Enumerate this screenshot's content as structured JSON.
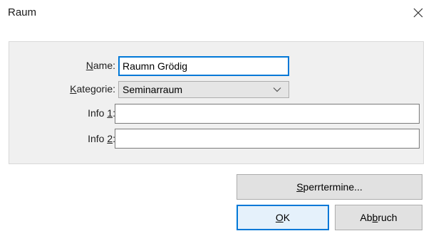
{
  "window": {
    "title": "Raum",
    "close_glyph": "close-icon"
  },
  "form": {
    "name": {
      "label_mnemonic": "N",
      "label_rest": "ame:",
      "value": "Raumn Grödig"
    },
    "kategorie": {
      "label_mnemonic": "K",
      "label_rest": "ategorie:",
      "value": "Seminarraum"
    },
    "info1": {
      "label_prefix": "Info ",
      "label_mnemonic": "1",
      "label_suffix": ":",
      "value": ""
    },
    "info2": {
      "label_prefix": "Info ",
      "label_mnemonic": "2",
      "label_suffix": ":",
      "value": ""
    }
  },
  "buttons": {
    "sperrtermine": {
      "mnemonic": "S",
      "rest": "perrtermine..."
    },
    "ok": {
      "mnemonic": "O",
      "rest": "K"
    },
    "abbruch": {
      "prefix": "Ab",
      "mnemonic": "b",
      "rest": "ruch"
    }
  },
  "colors": {
    "focus_accent": "#0078d7",
    "group_background": "#f0f0f0",
    "button_face": "#e1e1e1"
  }
}
